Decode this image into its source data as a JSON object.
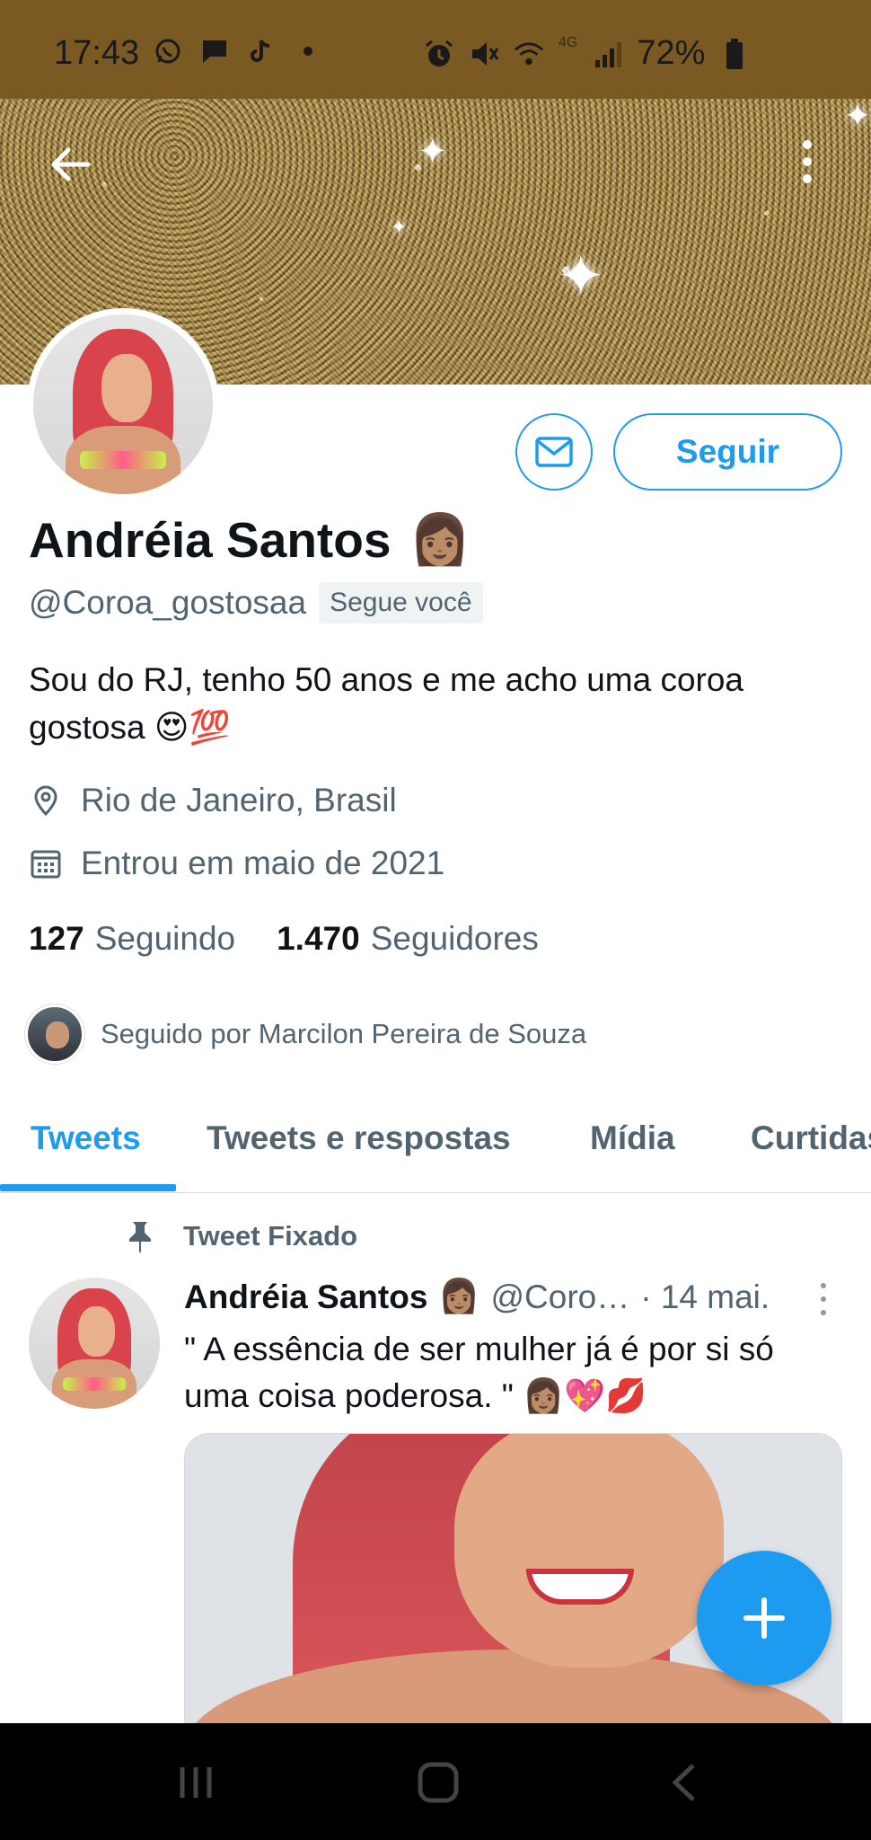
{
  "status_bar": {
    "time": "17:43",
    "battery": "72%",
    "network": "4G",
    "left_icons": [
      "whatsapp-icon",
      "chat-icon",
      "tiktok-icon",
      "dot-icon"
    ],
    "right_icons": [
      "alarm-icon",
      "mute-icon",
      "wifi-icon",
      "signal-icon",
      "battery-icon"
    ]
  },
  "header": {
    "back_icon": "arrow-left-icon",
    "more_icon": "more-vertical-icon"
  },
  "profile": {
    "name": "Andréia Santos",
    "name_emoji": "👩🏽",
    "handle": "@Coroa_gostosaa",
    "follows_you": "Segue você",
    "bio_text": "Sou do RJ, tenho 50 anos e me acho uma coroa gostosa",
    "bio_emoji": "😍💯",
    "location": "Rio de Janeiro, Brasil",
    "joined": "Entrou em maio de 2021",
    "following_count": "127",
    "following_label": "Seguindo",
    "followers_count": "1.470",
    "followers_label": "Seguidores",
    "followed_by": "Seguido por Marcilon Pereira de Souza",
    "follow_button": "Seguir"
  },
  "tabs": [
    {
      "label": "Tweets",
      "active": true
    },
    {
      "label": "Tweets e respostas",
      "active": false
    },
    {
      "label": "Mídia",
      "active": false
    },
    {
      "label": "Curtidas",
      "active": false
    }
  ],
  "tweet": {
    "pinned_label": "Tweet Fixado",
    "author": "Andréia Santos",
    "author_emoji": "👩🏽",
    "handle": "@Coro…",
    "date": "· 14 mai.",
    "text": "\" A essência de ser mulher já é por si só uma coisa poderosa. \"",
    "text_emoji": "👩🏽💖💋"
  },
  "colors": {
    "accent": "#1d9bf0",
    "status_bar": "#7a5a22",
    "secondary_text": "#536471"
  }
}
